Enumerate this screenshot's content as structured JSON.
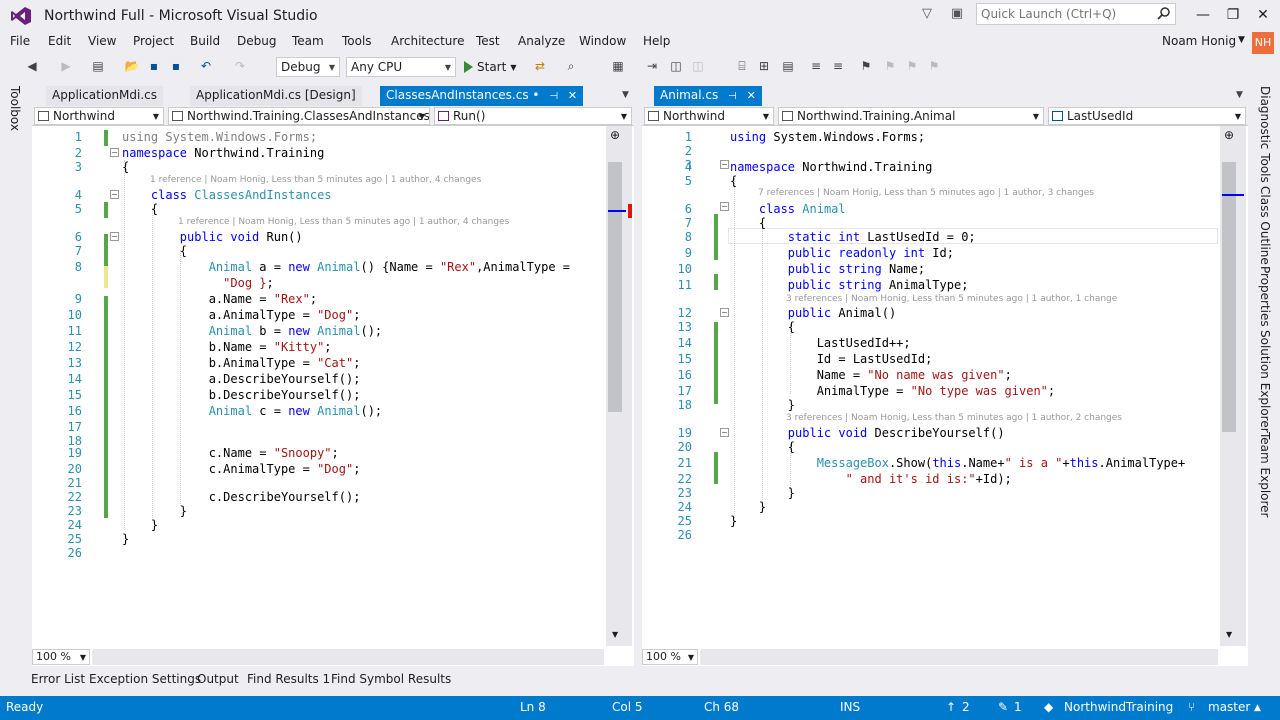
{
  "window": {
    "title": "Northwind Full - Microsoft Visual Studio",
    "quick_launch_placeholder": "Quick Launch (Ctrl+Q)",
    "user_name": "Noam Honig",
    "user_initials": "NH"
  },
  "menu": [
    "File",
    "Edit",
    "View",
    "Project",
    "Build",
    "Debug",
    "Team",
    "Tools",
    "Architecture",
    "Test",
    "Analyze",
    "Window",
    "Help"
  ],
  "toolbar": {
    "configuration": "Debug",
    "platform": "Any CPU",
    "start_label": "Start"
  },
  "left_sidebar": {
    "toolbox": "Toolbox"
  },
  "right_sidebar": [
    "Diagnostic Tools",
    "Class Outline",
    "Properties",
    "Solution Explorer",
    "Team Explorer"
  ],
  "left_pane": {
    "tabs": [
      {
        "label": "ApplicationMdi.cs"
      },
      {
        "label": "ApplicationMdi.cs [Design]"
      },
      {
        "label": "ClassesAndInstances.cs",
        "dirty": "•"
      }
    ],
    "nav": {
      "project": "Northwind",
      "type": "Northwind.Training.ClassesAndInstances",
      "member": "Run()"
    },
    "zoom": "100 %",
    "lens": {
      "class": "1 reference | Noam Honig, Less than 5 minutes ago | 1 author, 4 changes",
      "run": "1 reference | Noam Honig, Less than 5 minutes ago | 1 author, 4 changes"
    }
  },
  "right_pane": {
    "tabs": [
      {
        "label": "Animal.cs"
      }
    ],
    "nav": {
      "project": "Northwind",
      "type": "Northwind.Training.Animal",
      "member": "LastUsedId"
    },
    "zoom": "100 %",
    "lens": {
      "class": "7 references | Noam Honig, Less than 5 minutes ago | 1 author, 3 changes",
      "ctor": "3 references | Noam Honig, Less than 5 minutes ago | 1 author, 1 change",
      "describe": "3 references | Noam Honig, Less than 5 minutes ago | 1 author, 2 changes"
    }
  },
  "bottom_tabs": [
    "Error List",
    "Exception Settings",
    "Output",
    "Find Results 1",
    "Find Symbol Results"
  ],
  "status": {
    "state": "Ready",
    "line": "Ln 8",
    "col": "Col 5",
    "ch": "Ch 68",
    "mode": "INS",
    "pushes": "2",
    "changes": "1",
    "repo": "NorthwindTraining",
    "branch": "master"
  },
  "colors": {
    "accent": "#007acc",
    "status_bar": "#007acc",
    "avatar": "#ef6c3b"
  }
}
